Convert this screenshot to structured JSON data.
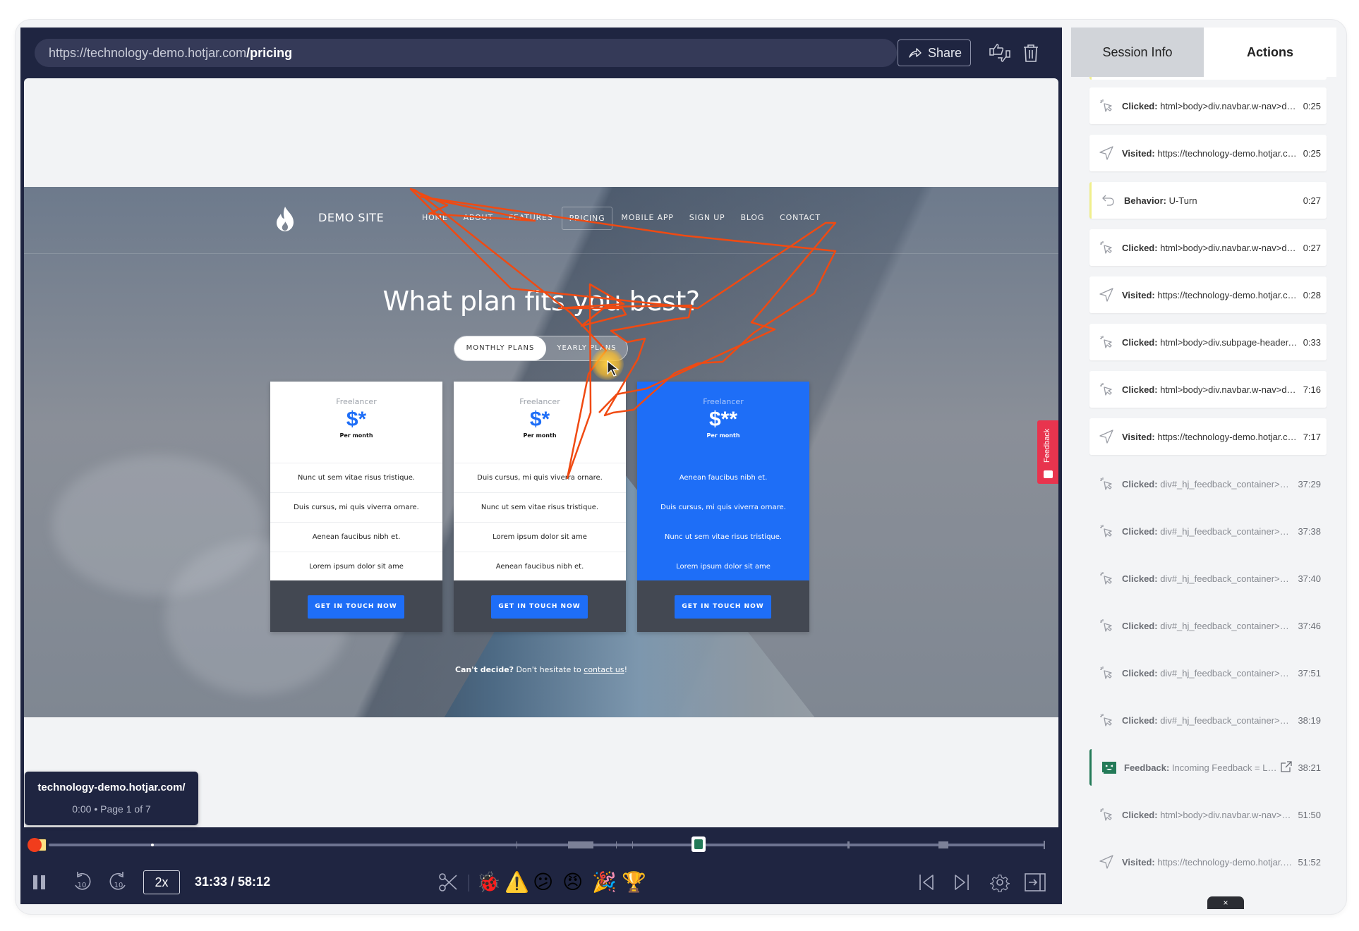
{
  "player": {
    "url_base": "https://technology-demo.hotjar.com",
    "url_path": "/pricing",
    "share_label": "Share",
    "icons": {
      "share": "share-arrow-icon",
      "rate": "thumbs-up-down-icon",
      "delete": "trash-icon"
    }
  },
  "site": {
    "brand": "DEMO SITE",
    "menu": [
      "HOME",
      "ABOUT",
      "FEATURES",
      "PRICING",
      "MOBILE APP",
      "SIGN UP",
      "BLOG",
      "CONTACT"
    ],
    "active_menu": "PRICING",
    "title": "What plan fits you best?",
    "toggle": {
      "monthly": "MONTHLY PLANS",
      "yearly": "YEARLY PLANS"
    },
    "cards": [
      {
        "plan": "Freelancer",
        "price": "$*",
        "per": "Per month",
        "featured": false,
        "features": [
          "Nunc ut sem vitae risus tristique.",
          "Duis cursus, mi quis viverra ornare.",
          "Aenean faucibus nibh et.",
          "Lorem ipsum dolor sit ame"
        ],
        "cta": "GET IN TOUCH NOW"
      },
      {
        "plan": "Freelancer",
        "price": "$*",
        "per": "Per month",
        "featured": false,
        "features": [
          "Duis cursus, mi quis viverra ornare.",
          "Nunc ut sem vitae risus tristique.",
          "Lorem ipsum dolor sit ame",
          "Aenean faucibus nibh et."
        ],
        "cta": "GET IN TOUCH NOW"
      },
      {
        "plan": "Freelancer",
        "price": "$**",
        "per": "Per month",
        "featured": true,
        "features": [
          "Aenean faucibus nibh et.",
          "Duis cursus, mi quis viverra ornare.",
          "Nunc ut sem vitae risus tristique.",
          "Lorem ipsum dolor sit ame"
        ],
        "cta": "GET IN TOUCH NOW"
      }
    ],
    "cant_decide_bold": "Can't decide?",
    "cant_decide_text": " Don't hesitate to ",
    "cant_decide_link": "contact us",
    "cant_decide_end": "!",
    "feedback_tab": "Feedback"
  },
  "hover_tooltip": {
    "page": "technology-demo.hotjar.com/",
    "meta": "0:00 • Page 1 of 7"
  },
  "playback": {
    "speed": "2x",
    "current_time": "31:33",
    "total_time": "58:12",
    "time_display": "31:33 / 58:12",
    "progress_fraction": 0.542,
    "skip_back": "10",
    "skip_forward": "10",
    "reactions": [
      "ladybug",
      "warning",
      "confused-face",
      "angry-face",
      "party-popper",
      "trophy"
    ],
    "reaction_glyphs": [
      "🐞",
      "⚠️",
      "😕",
      "😠",
      "🎉",
      "🏆"
    ]
  },
  "sidebar": {
    "tabs": [
      {
        "label": "Session Info",
        "active": false
      },
      {
        "label": "Actions",
        "active": true
      }
    ],
    "actions": [
      {
        "type": "click",
        "label": "Clicked:",
        "detail": "html>body>div.navbar.w-nav>div....",
        "time": "0:25",
        "style": "card"
      },
      {
        "type": "visit",
        "label": "Visited:",
        "detail": "https://technology-demo.hotjar.co...",
        "time": "0:25",
        "style": "card"
      },
      {
        "type": "behavior",
        "label": "Behavior:",
        "detail": "U-Turn",
        "time": "0:27",
        "style": "card behavior"
      },
      {
        "type": "click",
        "label": "Clicked:",
        "detail": "html>body>div.navbar.w-nav>div....",
        "time": "0:27",
        "style": "card"
      },
      {
        "type": "visit",
        "label": "Visited:",
        "detail": "https://technology-demo.hotjar.co...",
        "time": "0:28",
        "style": "card"
      },
      {
        "type": "click",
        "label": "Clicked:",
        "detail": "html>body>div.subpage-header.s...",
        "time": "0:33",
        "style": "card"
      },
      {
        "type": "click",
        "label": "Clicked:",
        "detail": "html>body>div.navbar.w-nav>div....",
        "time": "7:16",
        "style": "card"
      },
      {
        "type": "visit",
        "label": "Visited:",
        "detail": "https://technology-demo.hotjar.co...",
        "time": "7:17",
        "style": "card"
      },
      {
        "type": "click",
        "label": "Clicked:",
        "detail": "div#_hj_feedback_container>div...",
        "time": "37:29",
        "style": "flat"
      },
      {
        "type": "click",
        "label": "Clicked:",
        "detail": "div#_hj_feedback_container>div...",
        "time": "37:38",
        "style": "flat"
      },
      {
        "type": "click",
        "label": "Clicked:",
        "detail": "div#_hj_feedback_container>div...",
        "time": "37:40",
        "style": "flat"
      },
      {
        "type": "click",
        "label": "Clicked:",
        "detail": "div#_hj_feedback_container>div...",
        "time": "37:46",
        "style": "flat"
      },
      {
        "type": "click",
        "label": "Clicked:",
        "detail": "div#_hj_feedback_container>div...",
        "time": "37:51",
        "style": "flat"
      },
      {
        "type": "click",
        "label": "Clicked:",
        "detail": "div#_hj_feedback_container>div...",
        "time": "38:19",
        "style": "flat"
      },
      {
        "type": "feedback",
        "label": "Feedback:",
        "detail": "Incoming Feedback = Love",
        "time": "38:21",
        "style": "flat fb"
      },
      {
        "type": "click",
        "label": "Clicked:",
        "detail": "html>body>div.navbar.w-nav>div...",
        "time": "51:50",
        "style": "flat"
      },
      {
        "type": "visit",
        "label": "Visited:",
        "detail": "https://technology-demo.hotjar.c...",
        "time": "51:52",
        "style": "flat"
      }
    ],
    "collapse_label": "×"
  },
  "colors": {
    "player_bg": "#1f2541",
    "accent_blue": "#1e6ef7",
    "trail": "#f04a12",
    "feedback_green": "#237a58",
    "feedback_tab": "#e8344e",
    "scrubber": "#f13d1c"
  }
}
